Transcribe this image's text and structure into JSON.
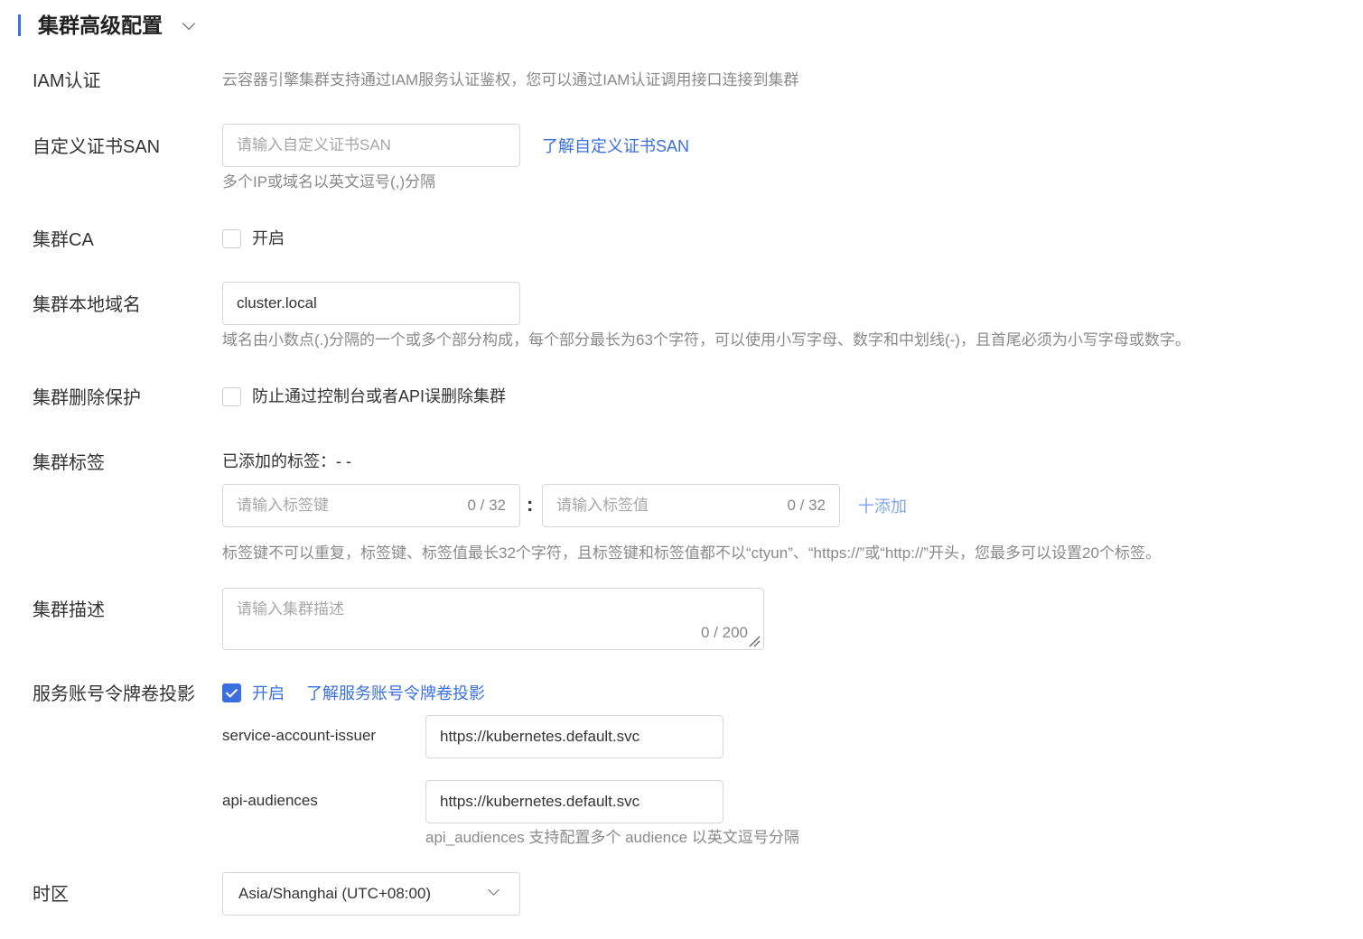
{
  "section": {
    "title": "集群高级配置",
    "chevron_icon": "chevron-down-icon"
  },
  "iam": {
    "label": "IAM认证",
    "desc": "云容器引擎集群支持通过IAM服务认证鉴权，您可以通过IAM认证调用接口连接到集群"
  },
  "san": {
    "label": "自定义证书SAN",
    "placeholder": "请输入自定义证书SAN",
    "value": "",
    "link": "了解自定义证书SAN",
    "hint": "多个IP或域名以英文逗号(,)分隔"
  },
  "ca": {
    "label": "集群CA",
    "checkbox_label": "开启",
    "checked": false
  },
  "domain": {
    "label": "集群本地域名",
    "value": "cluster.local",
    "hint": "域名由小数点(.)分隔的一个或多个部分构成，每个部分最长为63个字符，可以使用小写字母、数字和中划线(-)，且首尾必须为小写字母或数字。"
  },
  "delete_protect": {
    "label": "集群删除保护",
    "checkbox_label": "防止通过控制台或者API误删除集群",
    "checked": false
  },
  "tags": {
    "label": "集群标签",
    "added": "已添加的标签：- -",
    "key_placeholder": "请输入标签键",
    "key_counter": "0 / 32",
    "separator": ":",
    "value_placeholder": "请输入标签值",
    "value_counter": "0 / 32",
    "add": "十添加",
    "hint": "标签键不可以重复，标签键、标签值最长32个字符，且标签键和标签值都不以“ctyun”、“https://”或“http://”开头，您最多可以设置20个标签。"
  },
  "description": {
    "label": "集群描述",
    "placeholder": "请输入集群描述",
    "counter": "0 / 200"
  },
  "sa_token": {
    "label": "服务账号令牌卷投影",
    "checkbox_label": "开启",
    "checked": true,
    "link": "了解服务账号令牌卷投影",
    "issuer_label": "service-account-issuer",
    "issuer_value": "https://kubernetes.default.svc",
    "audiences_label": "api-audiences",
    "audiences_value": "https://kubernetes.default.svc",
    "audiences_hint": "api_audiences 支持配置多个 audience 以英文逗号分隔"
  },
  "timezone": {
    "label": "时区",
    "value": "Asia/Shanghai (UTC+08:00)"
  },
  "colors": {
    "accent": "#3a6fe0",
    "bar": "#3b6fe8",
    "hint": "#8a8a8a",
    "border": "#d6d6d6"
  }
}
